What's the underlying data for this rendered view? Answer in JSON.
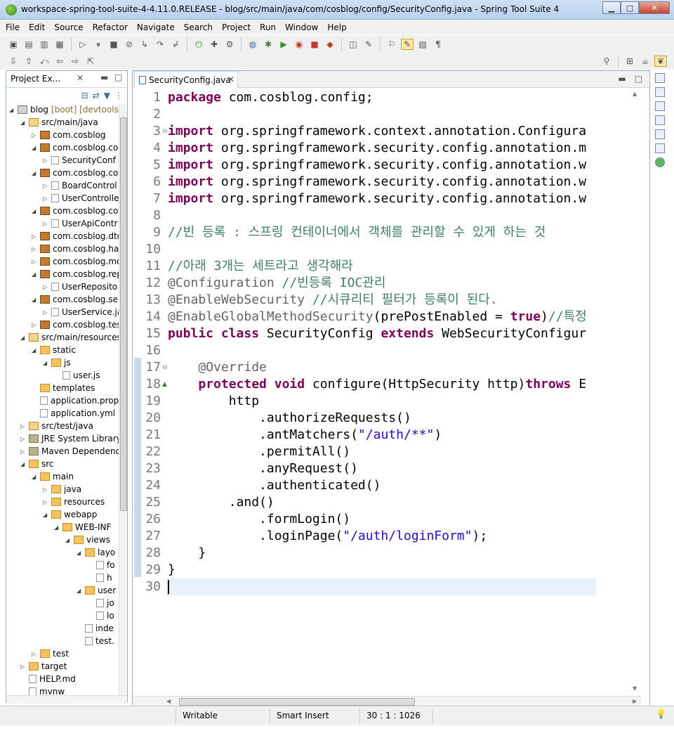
{
  "window": {
    "title": "workspace-spring-tool-suite-4-4.11.0.RELEASE - blog/src/main/java/com/cosblog/config/SecurityConfig.java - Spring Tool Suite 4",
    "buttons": {
      "minimize": "▁",
      "maximize": "□",
      "close": "✕"
    }
  },
  "menu": [
    "File",
    "Edit",
    "Source",
    "Refactor",
    "Navigate",
    "Search",
    "Project",
    "Run",
    "Window",
    "Help"
  ],
  "project_explorer": {
    "tab_label": "Project Ex...",
    "tree": [
      {
        "label": "blog",
        "deco": "[boot] [devtools]",
        "level": 0,
        "icon": "proj",
        "expanded": true
      },
      {
        "label": "src/main/java",
        "level": 1,
        "icon": "srcf",
        "expanded": true
      },
      {
        "label": "com.cosblog",
        "level": 2,
        "icon": "pkg",
        "expanded": false
      },
      {
        "label": "com.cosblog.co",
        "level": 2,
        "icon": "pkg",
        "expanded": true
      },
      {
        "label": "SecurityConf",
        "level": 3,
        "icon": "file",
        "expanded": false
      },
      {
        "label": "com.cosblog.co",
        "level": 2,
        "icon": "pkg",
        "expanded": true
      },
      {
        "label": "BoardControl",
        "level": 3,
        "icon": "file",
        "expanded": false
      },
      {
        "label": "UserControlle",
        "level": 3,
        "icon": "file",
        "expanded": false
      },
      {
        "label": "com.cosblog.co",
        "level": 2,
        "icon": "pkg",
        "expanded": true
      },
      {
        "label": "UserApiContr",
        "level": 3,
        "icon": "file",
        "expanded": false
      },
      {
        "label": "com.cosblog.dto",
        "level": 2,
        "icon": "pkg",
        "expanded": false
      },
      {
        "label": "com.cosblog.ha",
        "level": 2,
        "icon": "pkg",
        "expanded": false
      },
      {
        "label": "com.cosblog.mo",
        "level": 2,
        "icon": "pkg",
        "expanded": false
      },
      {
        "label": "com.cosblog.rep",
        "level": 2,
        "icon": "pkg",
        "expanded": true
      },
      {
        "label": "UserReposito",
        "level": 3,
        "icon": "file",
        "expanded": false
      },
      {
        "label": "com.cosblog.ser",
        "level": 2,
        "icon": "pkg",
        "expanded": true
      },
      {
        "label": "UserService.ja",
        "level": 3,
        "icon": "file",
        "expanded": false
      },
      {
        "label": "com.cosblog.tes",
        "level": 2,
        "icon": "pkg",
        "expanded": false
      },
      {
        "label": "src/main/resources",
        "level": 1,
        "icon": "srcf",
        "expanded": true
      },
      {
        "label": "static",
        "level": 2,
        "icon": "folder",
        "expanded": true
      },
      {
        "label": "js",
        "level": 3,
        "icon": "folder",
        "expanded": true
      },
      {
        "label": "user.js",
        "level": 4,
        "icon": "file",
        "expanded": null
      },
      {
        "label": "templates",
        "level": 2,
        "icon": "folder",
        "expanded": null
      },
      {
        "label": "application.prop",
        "level": 2,
        "icon": "file",
        "expanded": null
      },
      {
        "label": "application.yml",
        "level": 2,
        "icon": "file",
        "expanded": null
      },
      {
        "label": "src/test/java",
        "level": 1,
        "icon": "srcf",
        "expanded": false
      },
      {
        "label": "JRE System Library",
        "level": 1,
        "icon": "lib",
        "expanded": false
      },
      {
        "label": "Maven Dependenc",
        "level": 1,
        "icon": "lib",
        "expanded": false
      },
      {
        "label": "src",
        "level": 1,
        "icon": "folder",
        "expanded": true
      },
      {
        "label": "main",
        "level": 2,
        "icon": "folder",
        "expanded": true
      },
      {
        "label": "java",
        "level": 3,
        "icon": "folder",
        "expanded": false
      },
      {
        "label": "resources",
        "level": 3,
        "icon": "folder",
        "expanded": false
      },
      {
        "label": "webapp",
        "level": 3,
        "icon": "folder",
        "expanded": true
      },
      {
        "label": "WEB-INF",
        "level": 4,
        "icon": "folder",
        "expanded": true
      },
      {
        "label": "views",
        "level": 5,
        "icon": "folder",
        "expanded": true
      },
      {
        "label": "layo",
        "level": 6,
        "icon": "folder",
        "expanded": true
      },
      {
        "label": "fo",
        "level": 7,
        "icon": "file",
        "expanded": null
      },
      {
        "label": "h",
        "level": 7,
        "icon": "file",
        "expanded": null
      },
      {
        "label": "user",
        "level": 6,
        "icon": "folder",
        "expanded": true
      },
      {
        "label": "jo",
        "level": 7,
        "icon": "file",
        "expanded": null
      },
      {
        "label": "lo",
        "level": 7,
        "icon": "file",
        "expanded": null
      },
      {
        "label": "inde",
        "level": 6,
        "icon": "file",
        "expanded": null
      },
      {
        "label": "test.",
        "level": 6,
        "icon": "file",
        "expanded": null
      },
      {
        "label": "test",
        "level": 2,
        "icon": "folder",
        "expanded": false
      },
      {
        "label": "target",
        "level": 1,
        "icon": "folder",
        "expanded": false
      },
      {
        "label": "HELP.md",
        "level": 1,
        "icon": "file",
        "expanded": null
      },
      {
        "label": "mvnw",
        "level": 1,
        "icon": "file",
        "expanded": null
      }
    ]
  },
  "editor": {
    "tab_label": "SecurityConfig.java",
    "lines": [
      [
        [
          "kw",
          "package"
        ],
        [
          "",
          "com.cosblog.config;"
        ]
      ],
      [],
      [
        [
          "kw",
          "import"
        ],
        [
          "",
          "org.springframework.context.annotation.Configura"
        ]
      ],
      [
        [
          "kw",
          "import"
        ],
        [
          "",
          "org.springframework.security.config.annotation.m"
        ]
      ],
      [
        [
          "kw",
          "import"
        ],
        [
          "",
          "org.springframework.security.config.annotation.w"
        ]
      ],
      [
        [
          "kw",
          "import"
        ],
        [
          "",
          "org.springframework.security.config.annotation.w"
        ]
      ],
      [
        [
          "kw",
          "import"
        ],
        [
          "",
          "org.springframework.security.config.annotation.w"
        ]
      ],
      [],
      [
        [
          "cm",
          "//빈 등록 : 스프링 컨테이너에서 객체를 관리할 수 있게 하는 것"
        ]
      ],
      [],
      [
        [
          "cm",
          "//아래 3개는 세트라고 생각해라"
        ]
      ],
      [
        [
          "an",
          "@Configuration"
        ],
        [
          "cm",
          " //빈등록 IOC관리"
        ]
      ],
      [
        [
          "an",
          "@EnableWebSecurity"
        ],
        [
          "cm",
          " //시큐리티 필터가 등록이 된다."
        ]
      ],
      [
        [
          "an",
          "@EnableGlobalMethodSecurity"
        ],
        [
          "",
          "(prePostEnabled = "
        ],
        [
          "kw",
          "true"
        ],
        [
          "",
          ")"
        ],
        [
          "cm",
          "//특정"
        ]
      ],
      [
        [
          "kw",
          "public class"
        ],
        [
          "",
          " SecurityConfig "
        ],
        [
          "kw",
          "extends"
        ],
        [
          "",
          " WebSecurityConfigur"
        ]
      ],
      [],
      [
        [
          "",
          "    "
        ],
        [
          "an",
          "@Override"
        ]
      ],
      [
        [
          "",
          "    "
        ],
        [
          "kw",
          "protected void"
        ],
        [
          "",
          " configure(HttpSecurity http)"
        ],
        [
          "kw",
          "throws"
        ],
        [
          "",
          " E"
        ]
      ],
      [
        [
          "",
          "        http"
        ]
      ],
      [
        [
          "",
          "            .authorizeRequests()"
        ]
      ],
      [
        [
          "",
          "            .antMatchers("
        ],
        [
          "st",
          "\"/auth/**\""
        ],
        [
          "",
          ")"
        ]
      ],
      [
        [
          "",
          "            .permitAll()"
        ]
      ],
      [
        [
          "",
          "            .anyRequest()"
        ]
      ],
      [
        [
          "",
          "            .authenticated()"
        ]
      ],
      [
        [
          "",
          "        .and()"
        ]
      ],
      [
        [
          "",
          "            .formLogin()"
        ]
      ],
      [
        [
          "",
          "            .loginPage("
        ],
        [
          "st",
          "\"/auth/loginForm\""
        ],
        [
          "",
          ");"
        ]
      ],
      [
        [
          "",
          "    }"
        ]
      ],
      [
        [
          "",
          "}"
        ]
      ],
      []
    ],
    "line_numbers": [
      "1",
      "2",
      "3",
      "4",
      "5",
      "6",
      "7",
      "8",
      "9",
      "10",
      "11",
      "12",
      "13",
      "14",
      "15",
      "16",
      "17",
      "18",
      "19",
      "20",
      "21",
      "22",
      "23",
      "24",
      "25",
      "26",
      "27",
      "28",
      "29",
      "30"
    ],
    "fold_markers": {
      "3": "⊖",
      "17": "⊖",
      "18": "▲"
    },
    "current_line": 30
  },
  "status": {
    "writable": "Writable",
    "insert_mode": "Smart Insert",
    "position": "30 : 1 : 1026"
  },
  "colors": {
    "keyword": "#7f0055",
    "comment": "#3f7f5f",
    "annotation": "#646464",
    "string": "#2a00ff"
  }
}
